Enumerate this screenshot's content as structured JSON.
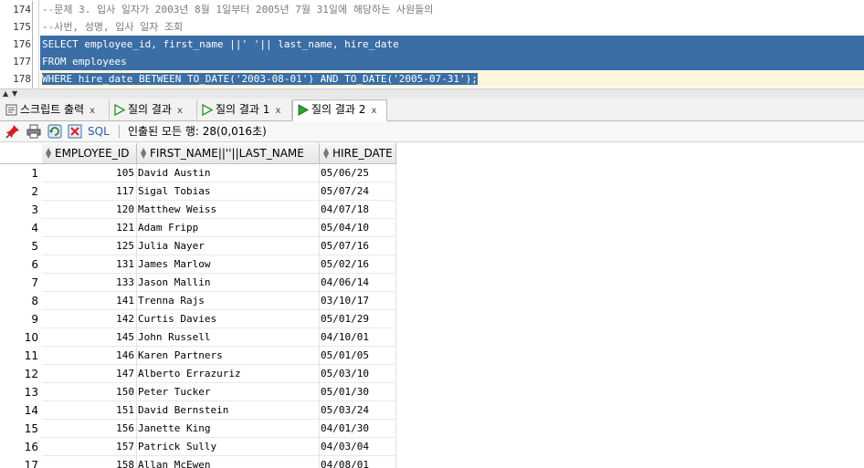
{
  "editor": {
    "lines": [
      {
        "num": "174",
        "text": "--문제 3. 입사 일자가 2003년 8월 1일부터 2005년 7월 31일에 해당하는 사원들의"
      },
      {
        "num": "175",
        "text": "--사번, 성명, 입사 일자 조회"
      },
      {
        "num": "176",
        "text": "SELECT employee_id, first_name ||' '|| last_name, hire_date"
      },
      {
        "num": "177",
        "text": "FROM employees"
      },
      {
        "num": "178",
        "text": "WHERE hire_date BETWEEN TO_DATE('2003-08-01') AND TO_DATE('2005-07-31');"
      }
    ]
  },
  "tabs": [
    {
      "label": "스크립트 출력",
      "icon": "script-output-icon"
    },
    {
      "label": "질의 결과",
      "icon": "run-query-icon"
    },
    {
      "label": "질의 결과 1",
      "icon": "run-query-icon"
    },
    {
      "label": "질의 결과 2",
      "icon": "run-query-icon"
    }
  ],
  "toolbar": {
    "sql_label": "SQL",
    "fetch_status": "인출된 모든 행: 28(0,016초)"
  },
  "grid": {
    "columns": [
      "EMPLOYEE_ID",
      "FIRST_NAME||''||LAST_NAME",
      "HIRE_DATE"
    ],
    "rows": [
      {
        "n": "1",
        "id": "105",
        "name": "David Austin",
        "date": "05/06/25"
      },
      {
        "n": "2",
        "id": "117",
        "name": "Sigal Tobias",
        "date": "05/07/24"
      },
      {
        "n": "3",
        "id": "120",
        "name": "Matthew Weiss",
        "date": "04/07/18"
      },
      {
        "n": "4",
        "id": "121",
        "name": "Adam Fripp",
        "date": "05/04/10"
      },
      {
        "n": "5",
        "id": "125",
        "name": "Julia Nayer",
        "date": "05/07/16"
      },
      {
        "n": "6",
        "id": "131",
        "name": "James Marlow",
        "date": "05/02/16"
      },
      {
        "n": "7",
        "id": "133",
        "name": "Jason Mallin",
        "date": "04/06/14"
      },
      {
        "n": "8",
        "id": "141",
        "name": "Trenna Rajs",
        "date": "03/10/17"
      },
      {
        "n": "9",
        "id": "142",
        "name": "Curtis Davies",
        "date": "05/01/29"
      },
      {
        "n": "10",
        "id": "145",
        "name": "John Russell",
        "date": "04/10/01"
      },
      {
        "n": "11",
        "id": "146",
        "name": "Karen Partners",
        "date": "05/01/05"
      },
      {
        "n": "12",
        "id": "147",
        "name": "Alberto Errazuriz",
        "date": "05/03/10"
      },
      {
        "n": "13",
        "id": "150",
        "name": "Peter Tucker",
        "date": "05/01/30"
      },
      {
        "n": "14",
        "id": "151",
        "name": "David Bernstein",
        "date": "05/03/24"
      },
      {
        "n": "15",
        "id": "156",
        "name": "Janette King",
        "date": "04/01/30"
      },
      {
        "n": "16",
        "id": "157",
        "name": "Patrick Sully",
        "date": "04/03/04"
      },
      {
        "n": "17",
        "id": "158",
        "name": "Allan McEwen",
        "date": "04/08/01"
      }
    ]
  }
}
